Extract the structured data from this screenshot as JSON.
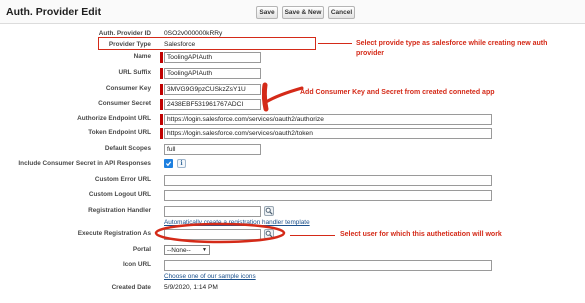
{
  "header": {
    "title": "Auth. Provider Edit",
    "save_label": "Save",
    "save_new_label": "Save & New",
    "cancel_label": "Cancel"
  },
  "fields": {
    "auth_provider_id": {
      "label": "Auth. Provider ID",
      "value": "0SO2v000000kRRy"
    },
    "provider_type": {
      "label": "Provider Type",
      "value": "Salesforce"
    },
    "name": {
      "label": "Name",
      "value": "ToolingAPIAuth"
    },
    "url_suffix": {
      "label": "URL Suffix",
      "value": "ToolingAPIAuth"
    },
    "consumer_key": {
      "label": "Consumer Key",
      "value": "3MVG9G9pzCUSkzZsY1U"
    },
    "consumer_secret": {
      "label": "Consumer Secret",
      "value": "2438EBF531961767ADCI"
    },
    "authorize_endpoint": {
      "label": "Authorize Endpoint URL",
      "value": "https://login.salesforce.com/services/oauth2/authorize"
    },
    "token_endpoint": {
      "label": "Token Endpoint URL",
      "value": "https://login.salesforce.com/services/oauth2/token"
    },
    "default_scopes": {
      "label": "Default Scopes",
      "value": "full"
    },
    "include_secret": {
      "label": "Include Consumer Secret in API Responses",
      "checked": true
    },
    "custom_error_url": {
      "label": "Custom Error URL",
      "value": ""
    },
    "custom_logout_url": {
      "label": "Custom Logout URL",
      "value": ""
    },
    "registration_handler": {
      "label": "Registration Handler",
      "value": "",
      "link": "Automatically create a registration handler template"
    },
    "execute_registration_as": {
      "label": "Execute Registration As",
      "value": ""
    },
    "portal": {
      "label": "Portal",
      "value": "--None--"
    },
    "icon_url": {
      "label": "Icon URL",
      "value": "",
      "link": "Choose one of our sample icons"
    },
    "created_date": {
      "label": "Created Date",
      "value": "5/9/2020, 1:14 PM"
    }
  },
  "annotations": {
    "provider_type": "Select provide type as salesforce while creating new auth provider",
    "consumer": "Add Consumer Key and Secret from created conneted app",
    "execute_as": "Select user for which this authetication will work"
  },
  "colors": {
    "annotation": "#d42a18",
    "required": "#c00000",
    "link": "#1a4f8b",
    "checkbox": "#1c7fe0"
  },
  "icons": {
    "info": "info-icon",
    "lookup": "lookup-icon"
  }
}
